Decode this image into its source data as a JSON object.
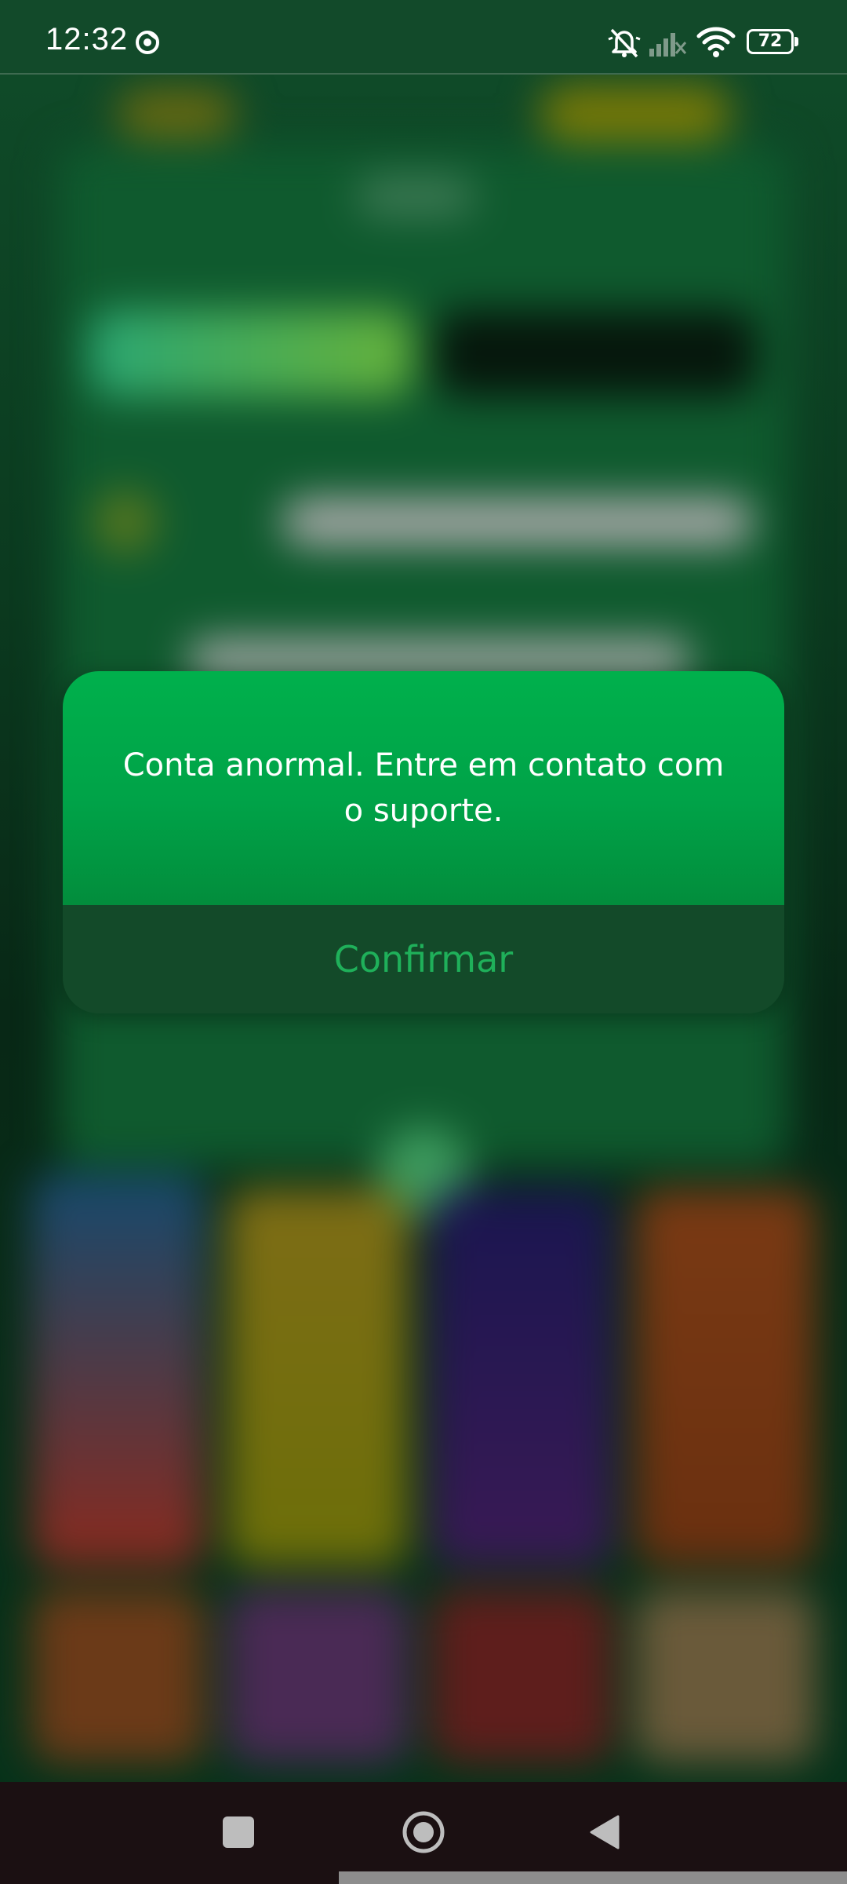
{
  "status_bar": {
    "time": "12:32",
    "battery_level": "72",
    "icons": [
      "chrome-icon",
      "dnd-icon",
      "signal-off-icon",
      "wifi-icon",
      "battery-icon"
    ]
  },
  "dialog": {
    "message": "Conta anormal. Entre em contato com o suporte.",
    "confirm_label": "Confirmar"
  },
  "colors": {
    "dialog_green": "#00b04c",
    "dialog_footer": "#134a29",
    "confirm_text": "#1fb05a",
    "status_bar": "#124a2a",
    "nav_bar": "#1b1012"
  },
  "nav_bar": {
    "icons": [
      "recents-icon",
      "home-icon",
      "back-icon"
    ]
  }
}
